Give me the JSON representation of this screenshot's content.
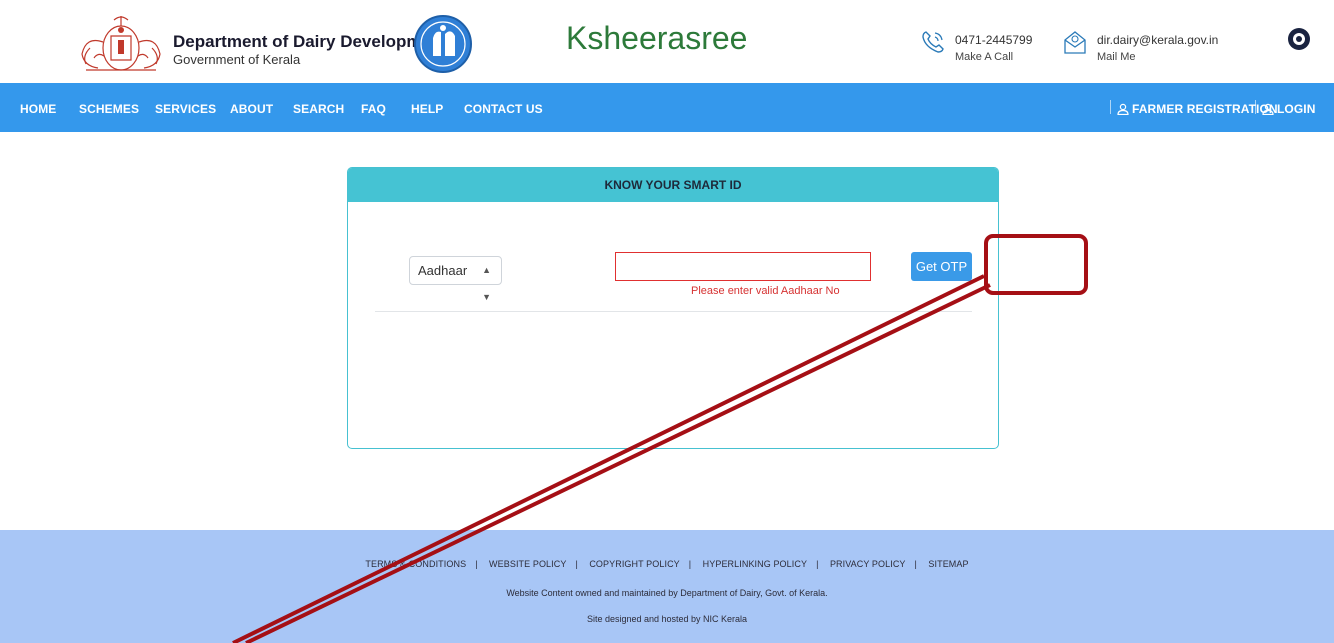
{
  "header": {
    "dept_name": "Department of Dairy Development",
    "dept_sub": "Government of Kerala",
    "site_title": "Ksheerasree",
    "phone": "0471-2445799",
    "phone_label": "Make A Call",
    "email": "dir.dairy@kerala.gov.in",
    "email_label": "Mail Me"
  },
  "nav": {
    "items": [
      "HOME",
      "SCHEMES",
      "SERVICES",
      "ABOUT",
      "SEARCH",
      "FAQ",
      "HELP",
      "CONTACT US"
    ],
    "farmer_registration": "FARMER REGISTRATION",
    "login": "LOGIN"
  },
  "card": {
    "title": "KNOW YOUR SMART ID",
    "id_type_selected": "Aadhaar",
    "id_value": "",
    "error": "Please enter valid Aadhaar No",
    "otp_button": "Get OTP"
  },
  "footer": {
    "links": [
      "TERMS & CONDITIONS",
      "WEBSITE POLICY",
      "COPYRIGHT POLICY",
      "HYPERLINKING POLICY",
      "PRIVACY POLICY",
      "SITEMAP"
    ],
    "ownership": "Website Content owned and maintained by Department of Dairy, Govt. of Kerala.",
    "hosting": "Site designed and hosted by NIC Kerala"
  },
  "colors": {
    "navbar": "#3498ec",
    "card_header": "#45c3d3",
    "footer": "#a8c6f6",
    "title_green": "#2d7a3a",
    "annotation": "#a50f15",
    "error": "#d63232"
  }
}
